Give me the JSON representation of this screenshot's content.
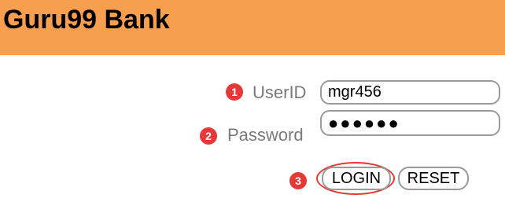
{
  "header": {
    "brand": "Guru99 Bank",
    "background_color": "#f79e4f"
  },
  "form": {
    "userid": {
      "step": "1",
      "label": "UserID",
      "value": "mgr456"
    },
    "password": {
      "step": "2",
      "label": "Password",
      "value": "●●●●●●"
    },
    "actions": {
      "step": "3",
      "login_label": "LOGIN",
      "reset_label": "RESET"
    }
  },
  "colors": {
    "marker": "#e53935",
    "label_text": "#7a7a7a"
  }
}
